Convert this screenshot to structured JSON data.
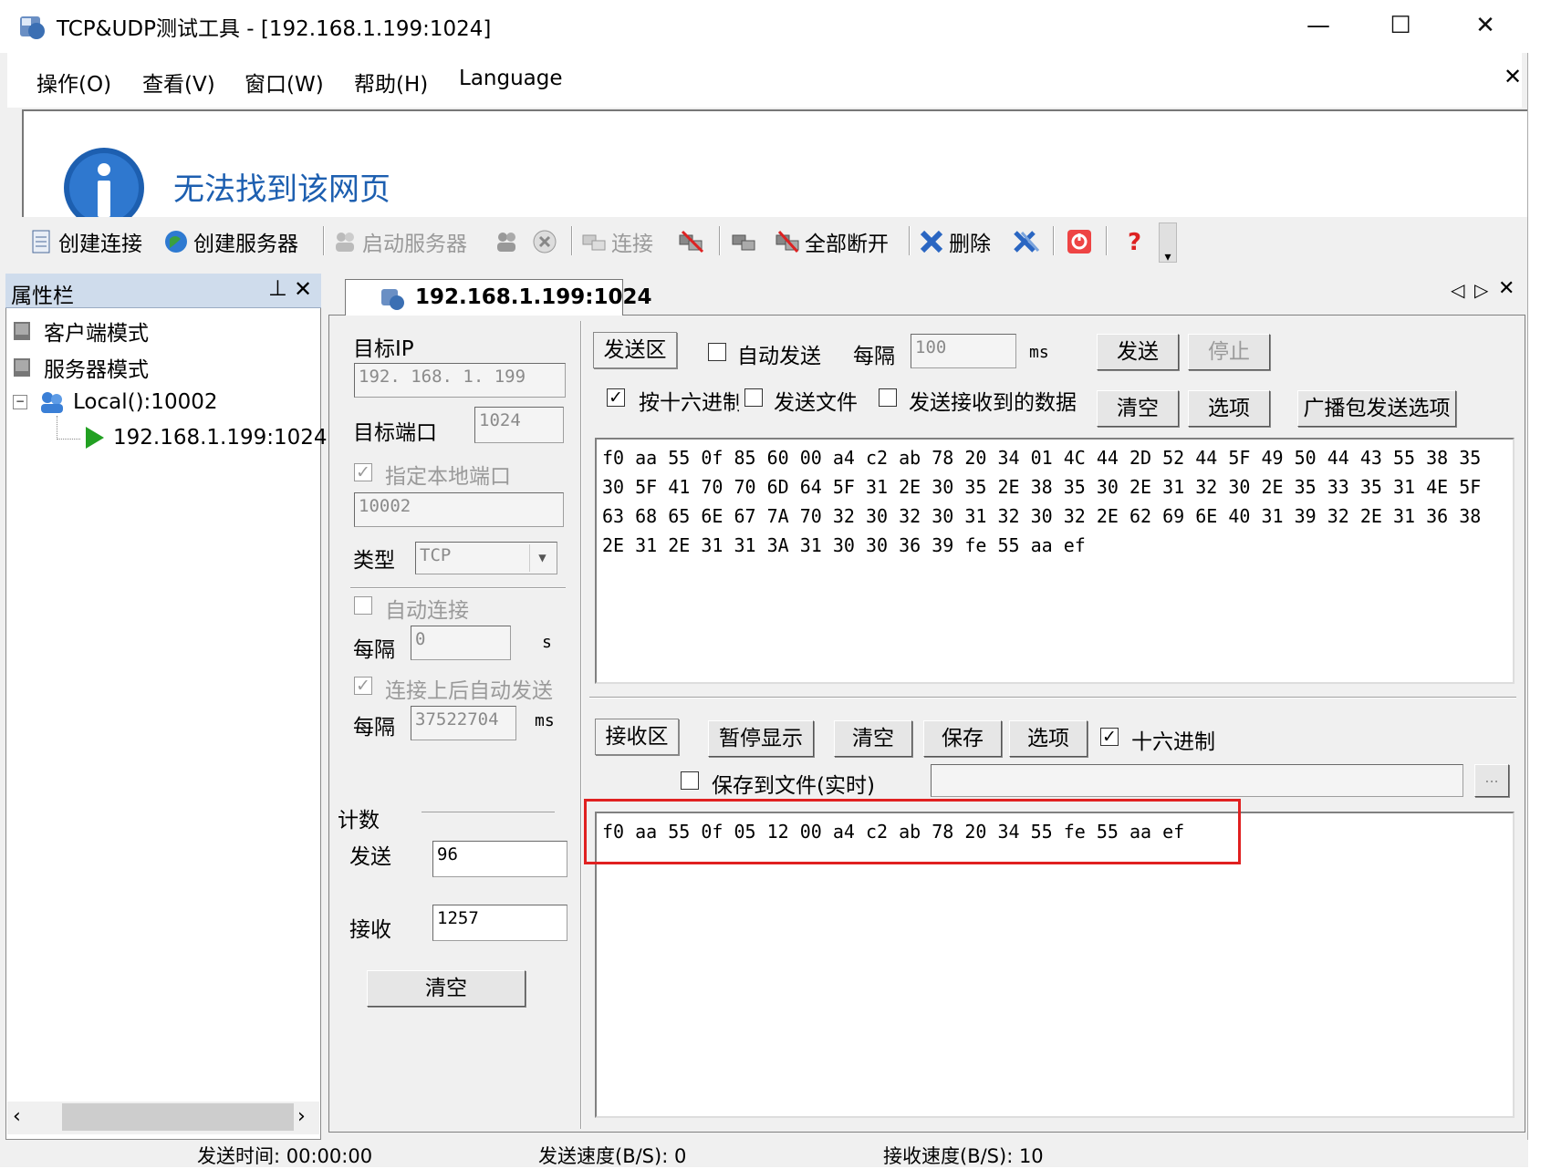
{
  "window": {
    "title": "TCP&UDP测试工具 - [192.168.1.199:1024]",
    "minimize": "—",
    "maximize": "☐",
    "close": "✕"
  },
  "menu": {
    "items": [
      "操作(O)",
      "查看(V)",
      "窗口(W)",
      "帮助(H)",
      "Language"
    ],
    "close": "✕"
  },
  "browser": {
    "message": "无法找到该网页"
  },
  "toolbar": {
    "create_connection": "创建连接",
    "create_server": "创建服务器",
    "start_server": "启动服务器",
    "connect": "连接",
    "disconnect_all": "全部断开",
    "delete": "删除"
  },
  "sidebar": {
    "title": "属性栏",
    "pin": "ᵖ",
    "close": "✕",
    "client_mode": "客户端模式",
    "server_mode": "服务器模式",
    "local": "Local():10002",
    "connection": "192.168.1.199:1024"
  },
  "tab": {
    "label": "192.168.1.199:1024"
  },
  "config": {
    "target_ip_label": "目标IP",
    "target_ip": "192. 168. 1. 199",
    "target_port_label": "目标端口",
    "target_port": "1024",
    "local_port_label": "指定本地端口",
    "local_port": "10002",
    "type_label": "类型",
    "type_value": "TCP",
    "auto_connect_label": "自动连接",
    "interval_label": "每隔",
    "interval_value": "0",
    "interval_unit": "s",
    "auto_send_label": "连接上后自动发送",
    "auto_interval_label": "每隔",
    "auto_interval_value": "37522704",
    "auto_interval_unit": "ms",
    "count_label": "计数",
    "sent_label": "发送",
    "sent_value": "96",
    "recv_label": "接收",
    "recv_value": "1257",
    "clear_label": "清空"
  },
  "send": {
    "area_label": "发送区",
    "auto_send": "自动发送",
    "interval_label": "每隔",
    "interval_value": "100",
    "interval_unit": "ms",
    "send_button": "发送",
    "stop_button": "停止",
    "hex_label": "按十六进制",
    "send_file": "发送文件",
    "send_received": "发送接收到的数据",
    "clear": "清空",
    "options": "选项",
    "broadcast_options": "广播包发送选项",
    "data_lines": [
      "f0 aa 55 0f 85 60 00 a4 c2 ab 78 20 34 01 4C 44 2D 52 44 5F 49 50 44 43 55 38 35",
      "30 5F 41 70 70 6D 64 5F 31 2E 30 35 2E 38 35 30 2E 31 32 30 2E 35 33 35 31 4E 5F",
      "63 68 65 6E 67 7A 70 32 30 32 30 31 32 30 32 2E 62 69 6E 40 31 39 32 2E 31 36 38",
      "2E 31 2E 31 31 3A 31 30 30 36 39 fe 55 aa ef"
    ]
  },
  "receive": {
    "area_label": "接收区",
    "pause": "暂停显示",
    "clear": "清空",
    "save": "保存",
    "options": "选项",
    "hex_label": "十六进制",
    "save_to_file": "保存到文件(实时)",
    "browse": "...",
    "data_lines": [
      "f0 aa 55 0f 05 12 00 a4 c2 ab 78 20 34 55 fe 55 aa ef"
    ]
  },
  "status": {
    "send_time": "发送时间: 00:00:00",
    "send_speed": "发送速度(B/S): 0",
    "recv_speed": "接收速度(B/S): 10"
  },
  "colors": {
    "highlight": "#e02020",
    "play": "#22a022",
    "info_blue": "#1d5fb0"
  }
}
